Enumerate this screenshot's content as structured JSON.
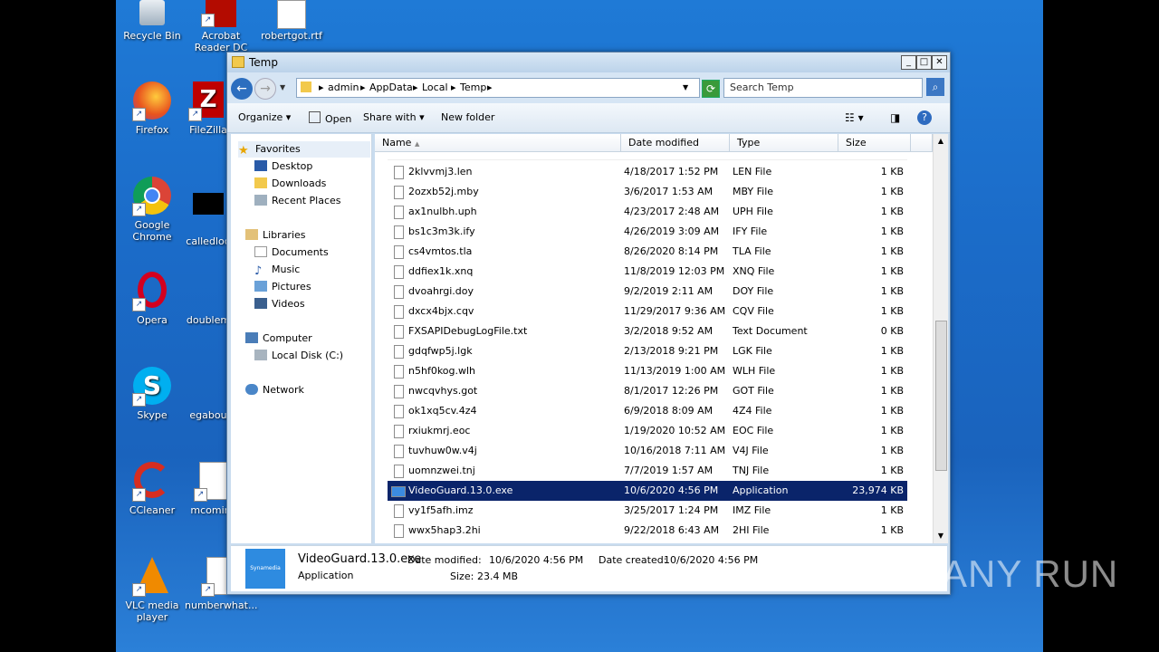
{
  "desktop": {
    "icons": [
      {
        "label": "Recycle Bin"
      },
      {
        "label": "Acrobat Reader DC"
      },
      {
        "label": "robertgot.rtf"
      },
      {
        "label": "Firefox"
      },
      {
        "label": "FileZilla"
      },
      {
        "label": "Google Chrome"
      },
      {
        "label": "calledlod"
      },
      {
        "label": "Opera"
      },
      {
        "label": "doublem"
      },
      {
        "label": "Skype"
      },
      {
        "label": "egabou"
      },
      {
        "label": "CCleaner"
      },
      {
        "label": "mcoming"
      },
      {
        "label": "VLC media player"
      },
      {
        "label": "numberwhat..."
      }
    ]
  },
  "window": {
    "title": "Temp",
    "search_placeholder": "Search Temp",
    "breadcrumb": [
      "admin",
      "AppData",
      "Local",
      "Temp"
    ],
    "toolbar": {
      "organize": "Organize",
      "open": "Open",
      "share_with": "Share with",
      "new_folder": "New folder"
    }
  },
  "navpane": {
    "favorites": "Favorites",
    "desktop": "Desktop",
    "downloads": "Downloads",
    "recent": "Recent Places",
    "libraries": "Libraries",
    "documents": "Documents",
    "music": "Music",
    "pictures": "Pictures",
    "videos": "Videos",
    "computer": "Computer",
    "local_disk": "Local Disk (C:)",
    "network": "Network"
  },
  "columns": {
    "name": "Name",
    "date": "Date modified",
    "type": "Type",
    "size": "Size"
  },
  "files": [
    {
      "name": "2klvvmj3.len",
      "date": "4/18/2017 1:52 PM",
      "type": "LEN File",
      "size": "1 KB"
    },
    {
      "name": "2ozxb52j.mby",
      "date": "3/6/2017 1:53 AM",
      "type": "MBY File",
      "size": "1 KB"
    },
    {
      "name": "ax1nulbh.uph",
      "date": "4/23/2017 2:48 AM",
      "type": "UPH File",
      "size": "1 KB"
    },
    {
      "name": "bs1c3m3k.ify",
      "date": "4/26/2019 3:09 AM",
      "type": "IFY File",
      "size": "1 KB"
    },
    {
      "name": "cs4vmtos.tla",
      "date": "8/26/2020 8:14 PM",
      "type": "TLA File",
      "size": "1 KB"
    },
    {
      "name": "ddfiex1k.xnq",
      "date": "11/8/2019 12:03 PM",
      "type": "XNQ File",
      "size": "1 KB"
    },
    {
      "name": "dvoahrgi.doy",
      "date": "9/2/2019 2:11 AM",
      "type": "DOY File",
      "size": "1 KB"
    },
    {
      "name": "dxcx4bjx.cqv",
      "date": "11/29/2017 9:36 AM",
      "type": "CQV File",
      "size": "1 KB"
    },
    {
      "name": "FXSAPIDebugLogFile.txt",
      "date": "3/2/2018 9:52 AM",
      "type": "Text Document",
      "size": "0 KB"
    },
    {
      "name": "gdqfwp5j.lgk",
      "date": "2/13/2018 9:21 PM",
      "type": "LGK File",
      "size": "1 KB"
    },
    {
      "name": "n5hf0kog.wlh",
      "date": "11/13/2019 1:00 AM",
      "type": "WLH File",
      "size": "1 KB"
    },
    {
      "name": "nwcqvhys.got",
      "date": "8/1/2017 12:26 PM",
      "type": "GOT File",
      "size": "1 KB"
    },
    {
      "name": "ok1xq5cv.4z4",
      "date": "6/9/2018 8:09 AM",
      "type": "4Z4 File",
      "size": "1 KB"
    },
    {
      "name": "rxiukmrj.eoc",
      "date": "1/19/2020 10:52 AM",
      "type": "EOC File",
      "size": "1 KB"
    },
    {
      "name": "tuvhuw0w.v4j",
      "date": "10/16/2018 7:11 AM",
      "type": "V4J File",
      "size": "1 KB"
    },
    {
      "name": "uomnzwei.tnj",
      "date": "7/7/2019 1:57 AM",
      "type": "TNJ File",
      "size": "1 KB"
    },
    {
      "name": "VideoGuard.13.0.exe",
      "date": "10/6/2020 4:56 PM",
      "type": "Application",
      "size": "23,974 KB"
    },
    {
      "name": "vy1f5afh.imz",
      "date": "3/25/2017 1:24 PM",
      "type": "IMZ File",
      "size": "1 KB"
    },
    {
      "name": "wwx5hap3.2hi",
      "date": "9/22/2018 6:43 AM",
      "type": "2HI File",
      "size": "1 KB"
    }
  ],
  "selected_file": "VideoGuard.13.0.exe",
  "details": {
    "name": "VideoGuard.13.0.exe",
    "type": "Application",
    "modified_label": "Date modified:",
    "modified": "10/6/2020 4:56 PM",
    "created_label": "Date created:",
    "created": "10/6/2020 4:56 PM",
    "size_label": "Size:",
    "size": "23.4 MB",
    "thumb_text": "Synamedia"
  },
  "watermark": "ANY RUN",
  "colors": {
    "selection": "#0a246a",
    "desktop": "#1b6cc9"
  }
}
